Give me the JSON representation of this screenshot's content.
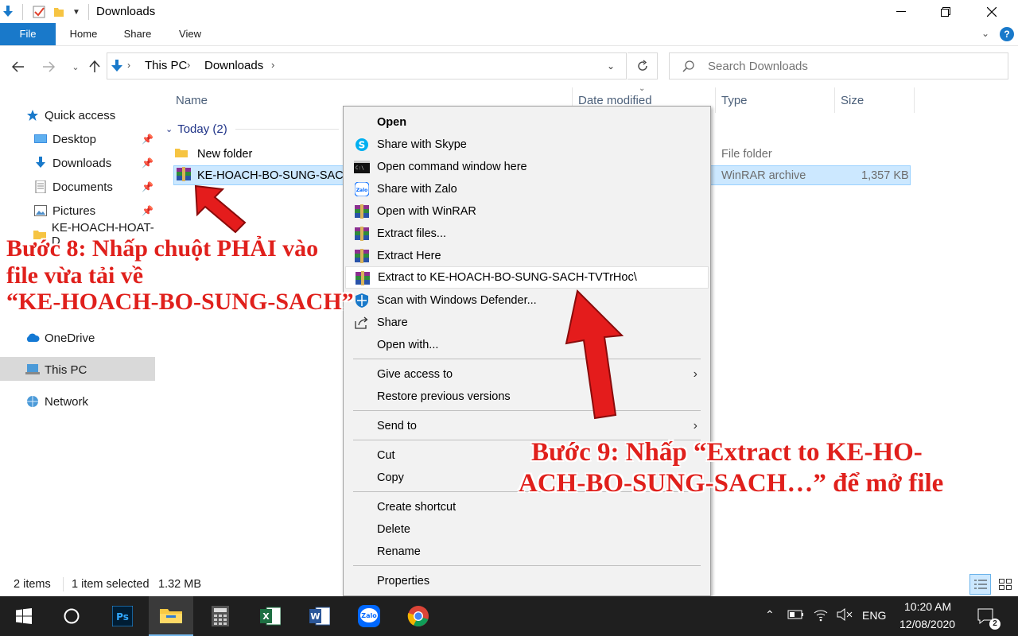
{
  "window": {
    "title": "Downloads"
  },
  "ribbon": {
    "tabs": [
      "File",
      "Home",
      "Share",
      "View"
    ]
  },
  "address": {
    "crumbs": [
      "This PC",
      "Downloads"
    ],
    "search_placeholder": "Search Downloads"
  },
  "sidebar": {
    "items": [
      {
        "label": "Quick access",
        "icon": "star-icon"
      },
      {
        "label": "Desktop",
        "icon": "desktop-icon",
        "pinned": true
      },
      {
        "label": "Downloads",
        "icon": "download-arrow-icon",
        "pinned": true
      },
      {
        "label": "Documents",
        "icon": "documents-icon",
        "pinned": true
      },
      {
        "label": "Pictures",
        "icon": "pictures-icon",
        "pinned": true
      },
      {
        "label": "KE-HOACH-HOAT-D",
        "icon": "folder-icon"
      },
      {
        "label": "OneDrive",
        "icon": "cloud-icon"
      },
      {
        "label": "This PC",
        "icon": "computer-icon",
        "selected": true
      },
      {
        "label": "Network",
        "icon": "network-icon"
      }
    ]
  },
  "columns": {
    "name": "Name",
    "date": "Date modified",
    "type": "Type",
    "size": "Size"
  },
  "group": {
    "label": "Today (2)"
  },
  "files": [
    {
      "name": "New folder",
      "type": "File folder",
      "size": ""
    },
    {
      "name": "KE-HOACH-BO-SUNG-SACH",
      "type": "WinRAR archive",
      "size": "1,357 KB",
      "selected": true
    }
  ],
  "context_menu": {
    "items": [
      {
        "label": "Open",
        "bold": true
      },
      {
        "label": "Share with Skype",
        "icon": "skype-icon"
      },
      {
        "label": "Open command window here",
        "icon": "cmd-icon"
      },
      {
        "label": "Share with Zalo",
        "icon": "zalo-icon"
      },
      {
        "label": "Open with WinRAR",
        "icon": "winrar-icon"
      },
      {
        "label": "Extract files...",
        "icon": "winrar-icon"
      },
      {
        "label": "Extract Here",
        "icon": "winrar-icon"
      },
      {
        "label": "Extract to KE-HOACH-BO-SUNG-SACH-TVTrHoc\\",
        "icon": "winrar-icon",
        "highlighted": true
      },
      {
        "label": "Scan with Windows Defender...",
        "icon": "defender-icon"
      },
      {
        "label": "Share",
        "icon": "share-icon"
      },
      {
        "label": "Open with..."
      },
      {
        "label": "Give access to",
        "submenu": true
      },
      {
        "label": "Restore previous versions"
      },
      {
        "label": "Send to",
        "submenu": true
      },
      {
        "label": "Cut"
      },
      {
        "label": "Copy"
      },
      {
        "label": "Create shortcut"
      },
      {
        "label": "Delete"
      },
      {
        "label": "Rename"
      },
      {
        "label": "Properties"
      }
    ]
  },
  "status": {
    "items_count": "2 items",
    "selection": "1 item selected",
    "size": "1.32 MB"
  },
  "taskbar": {
    "apps": [
      "start-icon",
      "cortana-icon",
      "photoshop-icon",
      "file-explorer-icon",
      "calculator-icon",
      "excel-icon",
      "word-icon",
      "zalo-icon",
      "chrome-icon"
    ],
    "language": "ENG",
    "time": "10:20 AM",
    "date": "12/08/2020",
    "notifications": "2"
  },
  "annotations": {
    "step8_line1": "Bước 8: Nhấp chuột PHẢI vào",
    "step8_line2": "file vừa tải về",
    "step8_line3": "“KE-HOACH-BO-SUNG-SACH”",
    "step9_line1": "Bước 9: Nhấp “Extract to KE-HO-",
    "step9_line2": "ACH-BO-SUNG-SACH…” để mở file"
  },
  "colors": {
    "accent": "#1979ca",
    "selection": "#cce8ff",
    "annotation_red": "#e0201c"
  }
}
